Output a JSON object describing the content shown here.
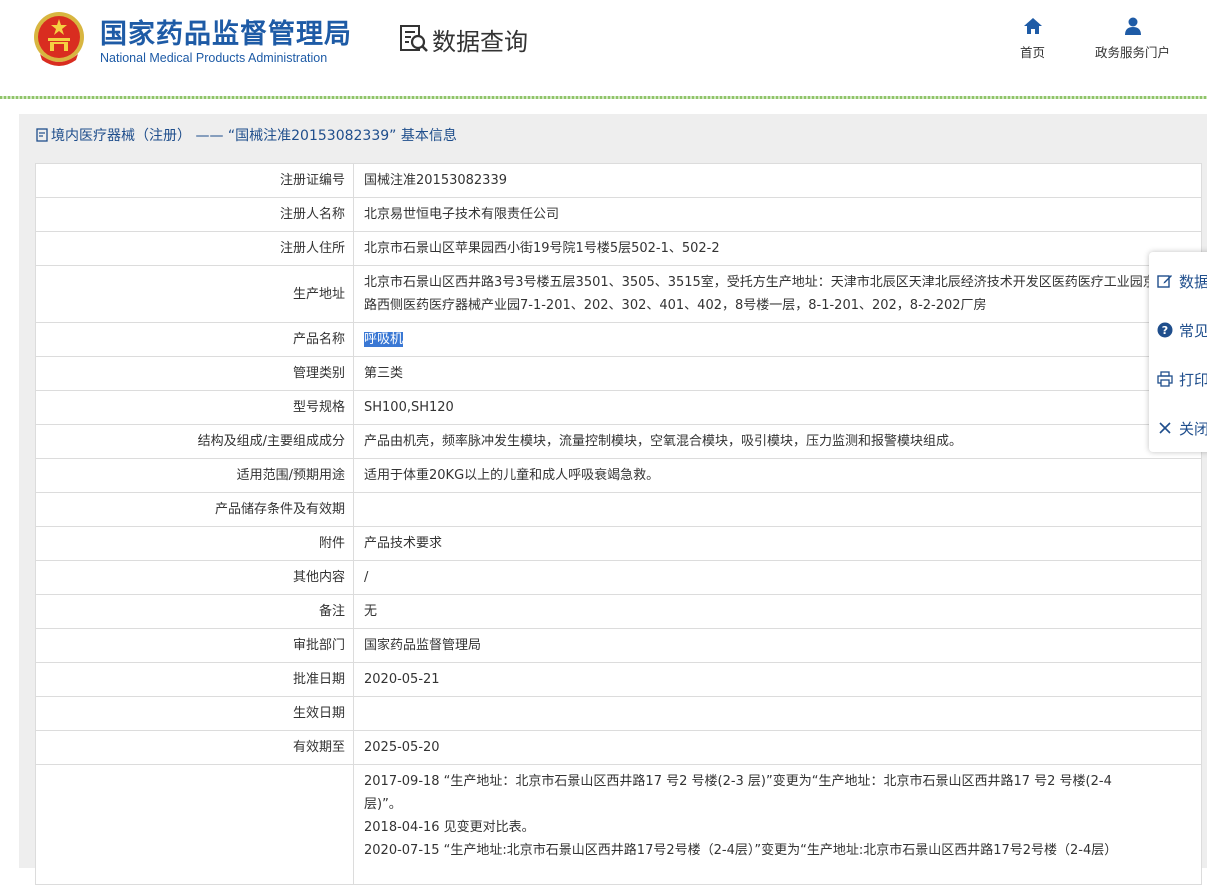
{
  "header": {
    "org_name_cn": "国家药品监督管理局",
    "org_name_en": "National Medical Products Administration",
    "section_title": "数据查询",
    "nav": [
      {
        "label": "首页",
        "icon": "home-icon"
      },
      {
        "label": "政务服务门户",
        "icon": "user-icon"
      }
    ]
  },
  "breadcrumb": "境内医疗器械（注册） —— “国械注准20153082339” 基本信息",
  "rows": [
    {
      "label": "注册证编号",
      "value": "国械注准20153082339"
    },
    {
      "label": "注册人名称",
      "value": "北京易世恒电子技术有限责任公司"
    },
    {
      "label": "注册人住所",
      "value": "北京市石景山区苹果园西小街19号院1号楼5层502-1、502-2"
    },
    {
      "label": "生产地址",
      "value": "北京市石景山区西井路3号3号楼五层3501、3505、3515室，受托方生产地址：天津市北辰区天津北辰经济技术开发区医药医疗工业园京福公路西侧医药医疗器械产业园7-1-201、202、302、401、402，8号楼一层，8-1-201、202，8-2-202厂房"
    },
    {
      "label": "产品名称",
      "value": "呼吸机"
    },
    {
      "label": "管理类别",
      "value": "第三类"
    },
    {
      "label": "型号规格",
      "value": "SH100,SH120"
    },
    {
      "label": "结构及组成/主要组成成分",
      "value": "产品由机壳，频率脉冲发生模块，流量控制模块，空氧混合模块，吸引模块，压力监测和报警模块组成。"
    },
    {
      "label": "适用范围/预期用途",
      "value": "适用于体重20KG以上的儿童和成人呼吸衰竭急救。"
    },
    {
      "label": "产品储存条件及有效期",
      "value": ""
    },
    {
      "label": "附件",
      "value": "产品技术要求"
    },
    {
      "label": "其他内容",
      "value": "/"
    },
    {
      "label": "备注",
      "value": "无"
    },
    {
      "label": "审批部门",
      "value": "国家药品监督管理局"
    },
    {
      "label": "批准日期",
      "value": "2020-05-21"
    },
    {
      "label": "生效日期",
      "value": ""
    },
    {
      "label": "有效期至",
      "value": "2025-05-20"
    }
  ],
  "changes": [
    "2017-09-18 “生产地址：北京市石景山区西井路17 号2 号楼(2-3 层)”变更为“生产地址：北京市石景山区西井路17 号2 号楼(2-4",
    "层)”。",
    "2018-04-16 见变更对比表。",
    "2020-07-15 “生产地址:北京市石景山区西井路17号2号楼（2-4层）”变更为“生产地址:北京市石景山区西井路17号2号楼（2-4层）"
  ],
  "side_tools": [
    {
      "label": "数据",
      "icon": "edit-icon"
    },
    {
      "label": "常见",
      "icon": "question-icon"
    },
    {
      "label": "打印",
      "icon": "print-icon"
    },
    {
      "label": "关闭",
      "icon": "close-icon"
    }
  ],
  "colors": {
    "brand": "#1e5ba6",
    "link": "#1f4e8c",
    "highlight": "#3a78d4"
  }
}
